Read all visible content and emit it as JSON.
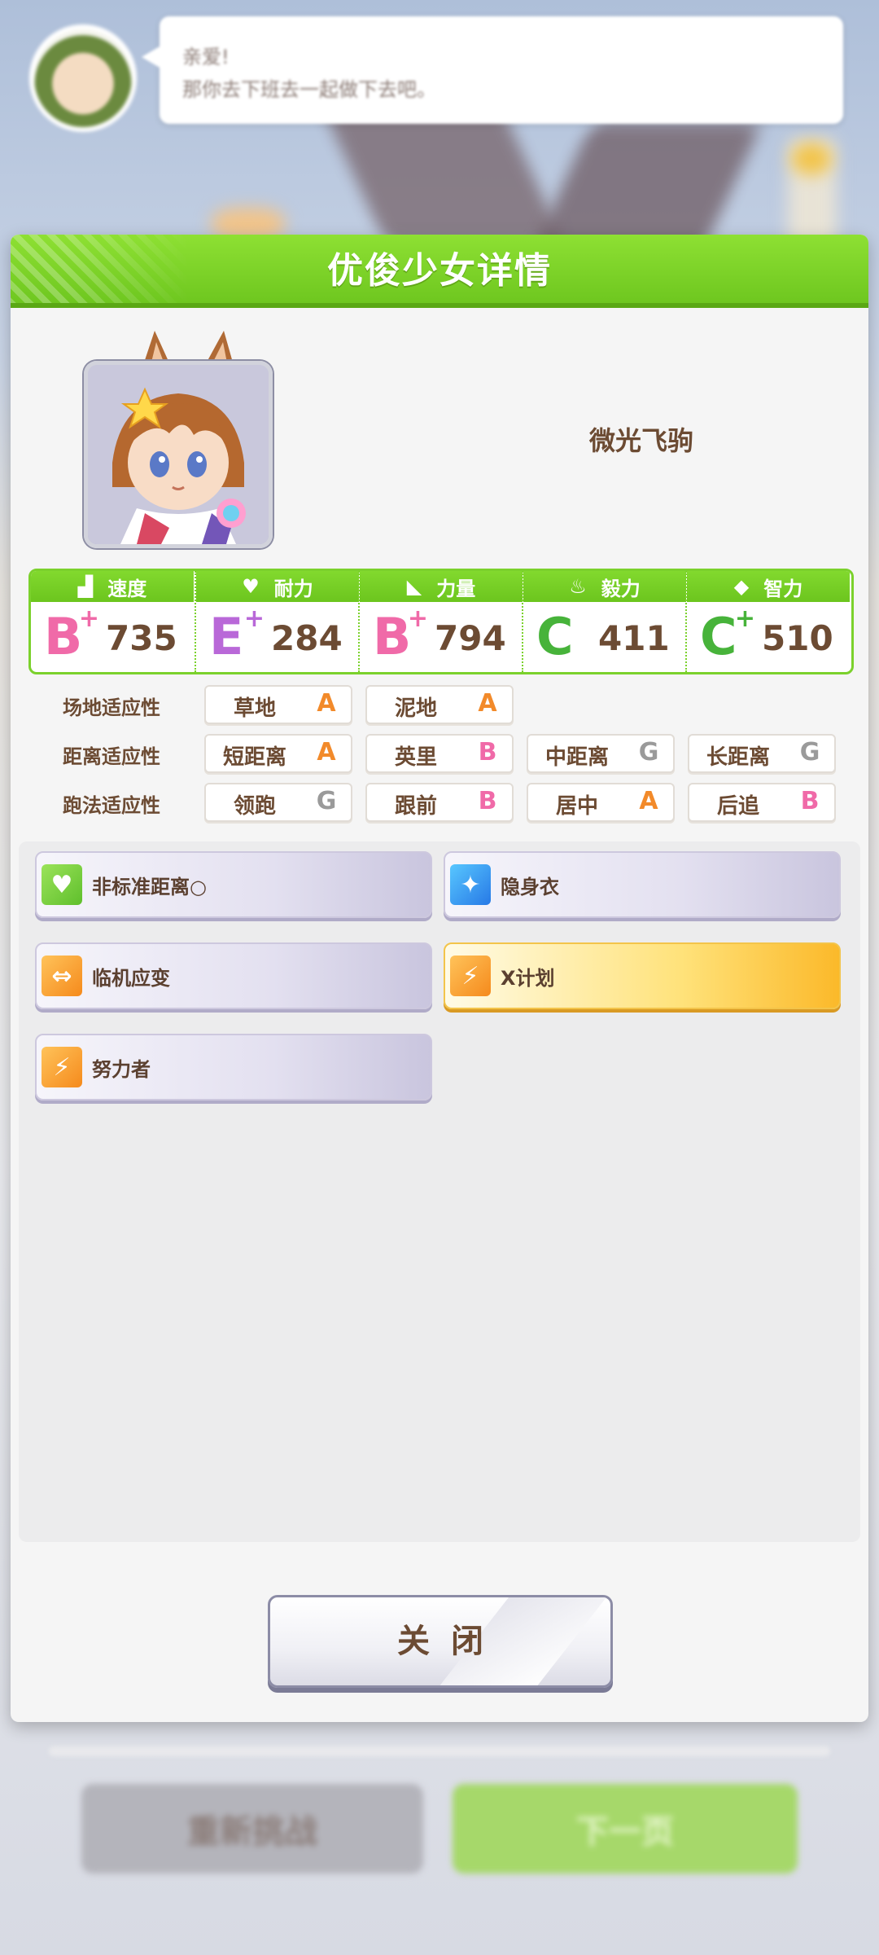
{
  "background": {
    "speech_line1": "亲爱!",
    "speech_line2": "那你去下班去一起做下去吧。",
    "retry_label": "重新挑战",
    "next_label": "下一页"
  },
  "dialog": {
    "title": "优俊少女详情",
    "character_name": "微光飞驹",
    "close_label": "关闭"
  },
  "stats": [
    {
      "label": "速度",
      "icon": "shoe-icon",
      "grade": "B",
      "plus": true,
      "value": "735"
    },
    {
      "label": "耐力",
      "icon": "heart-icon",
      "grade": "E",
      "plus": true,
      "value": "284"
    },
    {
      "label": "力量",
      "icon": "muscle-icon",
      "grade": "B",
      "plus": true,
      "value": "794"
    },
    {
      "label": "毅力",
      "icon": "flame-icon",
      "grade": "C",
      "plus": false,
      "value": "411"
    },
    {
      "label": "智力",
      "icon": "graduation-cap-icon",
      "grade": "C",
      "plus": true,
      "value": "510"
    }
  ],
  "aptitudes": {
    "track": {
      "label": "场地适应性",
      "items": [
        {
          "name": "草地",
          "grade": "A"
        },
        {
          "name": "泥地",
          "grade": "A"
        }
      ]
    },
    "distance": {
      "label": "距离适应性",
      "items": [
        {
          "name": "短距离",
          "grade": "A"
        },
        {
          "name": "英里",
          "grade": "B"
        },
        {
          "name": "中距离",
          "grade": "G"
        },
        {
          "name": "长距离",
          "grade": "G"
        }
      ]
    },
    "style": {
      "label": "跑法适应性",
      "items": [
        {
          "name": "领跑",
          "grade": "G"
        },
        {
          "name": "跟前",
          "grade": "B"
        },
        {
          "name": "居中",
          "grade": "A"
        },
        {
          "name": "后追",
          "grade": "B"
        }
      ]
    }
  },
  "skills": [
    {
      "name": "非标准距离○",
      "icon": "heart-icon",
      "color": "#7fd147"
    },
    {
      "name": "隐身衣",
      "icon": "sparkle-icon",
      "color": "#3d9ef0"
    },
    {
      "name": "临机应变",
      "icon": "arrows-icon",
      "color": "#f8a23a"
    },
    {
      "name": "X计划",
      "icon": "runner-icon",
      "color": "#f8a23a",
      "highlight": true
    },
    {
      "name": "努力者",
      "icon": "runner-icon",
      "color": "#f8a23a"
    }
  ]
}
